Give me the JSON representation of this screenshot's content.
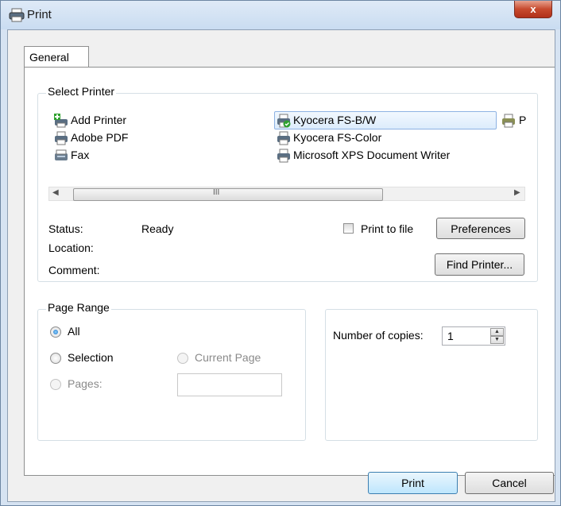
{
  "window": {
    "title": "Print",
    "close_glyph": "x"
  },
  "tab": {
    "label": "General"
  },
  "select_printer": {
    "legend": "Select Printer",
    "printers": [
      {
        "name": "Add Printer",
        "icon": "add-printer-icon"
      },
      {
        "name": "Adobe PDF",
        "icon": "printer-icon"
      },
      {
        "name": "Fax",
        "icon": "fax-icon"
      },
      {
        "name": "Kyocera FS-B/W",
        "icon": "default-printer-icon",
        "selected": true
      },
      {
        "name": "Kyocera FS-Color",
        "icon": "printer-icon"
      },
      {
        "name": "Microsoft XPS Document Writer",
        "icon": "printer-icon"
      },
      {
        "name": "P",
        "icon": "printer-icon"
      }
    ],
    "scrollbar": {
      "thumb_grip": "III"
    },
    "status_label": "Status:",
    "status_value": "Ready",
    "location_label": "Location:",
    "comment_label": "Comment:",
    "print_to_file_label": "Print to file",
    "preferences_label": "Preferences",
    "find_printer_label": "Find Printer..."
  },
  "page_range": {
    "legend": "Page Range",
    "all_label": "All",
    "selection_label": "Selection",
    "current_page_label": "Current Page",
    "pages_label": "Pages:",
    "selected": "All"
  },
  "copies": {
    "label": "Number of copies:",
    "value": "1"
  },
  "buttons": {
    "print": "Print",
    "cancel": "Cancel"
  }
}
